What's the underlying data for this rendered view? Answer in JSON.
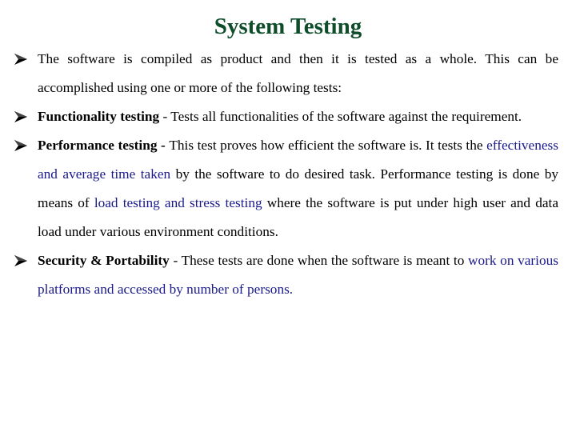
{
  "page": {
    "title": "System Testing"
  },
  "colors": {
    "title": "#0e4d2a",
    "highlight": "#1a1a8c",
    "body": "#000000"
  },
  "bullet_icon": "arrow-bullet-icon",
  "bullets": [
    {
      "intro": "The software is compiled as product and then it is tested as a whole. This can be accomplished using one or more of the following tests:"
    },
    {
      "term": "Functionality testing",
      "separator": " - ",
      "text": "Tests all functionalities of the software against the requirement."
    },
    {
      "term": "Performance testing",
      "separator": " - ",
      "text1": "This test proves how efficient the software is. It tests the ",
      "highlight1": "effectiveness and average time taken",
      "text2": " by the software to do desired task. Performance testing is done by means of ",
      "highlight2": "load testing and stress testing",
      "text3": " where the software is put under high user and data load under various environment conditions."
    },
    {
      "term": "Security & Portability",
      "separator": " - ",
      "text1": "These tests are done when the software is meant to ",
      "highlight1": "work on various platforms and accessed by number of persons."
    }
  ]
}
